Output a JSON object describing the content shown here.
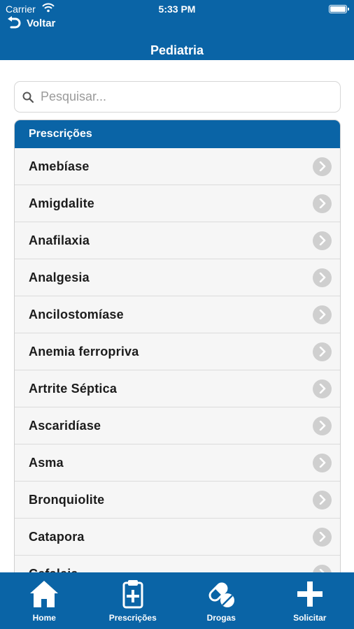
{
  "status": {
    "carrier": "Carrier",
    "time": "5:33 PM"
  },
  "nav": {
    "back_label": "Voltar",
    "title": "Pediatria"
  },
  "search": {
    "placeholder": "Pesquisar..."
  },
  "section": {
    "title": "Prescrições",
    "items": [
      "Amebíase",
      "Amigdalite",
      "Anafilaxia",
      "Analgesia",
      "Ancilostomíase",
      "Anemia ferropriva",
      "Artrite Séptica",
      "Ascaridíase",
      "Asma",
      "Bronquiolite",
      "Catapora",
      "Cefaleia"
    ]
  },
  "tabbar": {
    "home": "Home",
    "prescricoes": "Prescrições",
    "drogas": "Drogas",
    "solicitar": "Solicitar"
  },
  "colors": {
    "brand": "#0a64a6",
    "row_bg": "#f6f6f6",
    "chevron_bg": "#cfcfcf"
  },
  "icons": [
    "wifi-icon",
    "battery-icon",
    "back-arrow-icon",
    "search-icon",
    "chevron-right-icon",
    "home-icon",
    "clipboard-plus-icon",
    "pills-icon",
    "plus-icon"
  ]
}
